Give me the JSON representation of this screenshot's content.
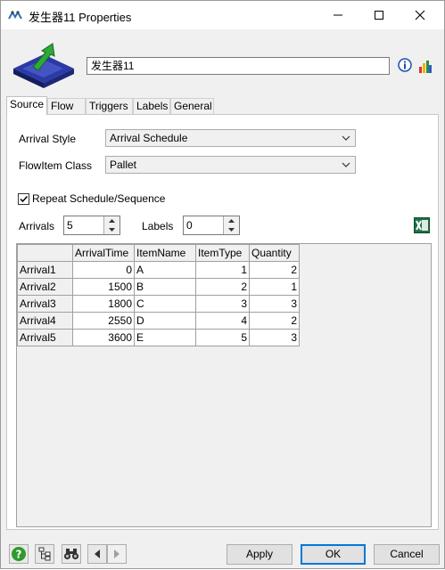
{
  "window": {
    "title": "发生器11  Properties"
  },
  "object": {
    "name": "发生器11"
  },
  "tabs": [
    "Source",
    "Flow",
    "Triggers",
    "Labels",
    "General"
  ],
  "source": {
    "arrival_style_label": "Arrival Style",
    "arrival_style_value": "Arrival Schedule",
    "flowitem_class_label": "FlowItem Class",
    "flowitem_class_value": "Pallet",
    "repeat_label": "Repeat Schedule/Sequence",
    "repeat_checked": true,
    "arrivals_label": "Arrivals",
    "arrivals_value": "5",
    "labels_label": "Labels",
    "labels_value": "0"
  },
  "table": {
    "columns": [
      "ArrivalTime",
      "ItemName",
      "ItemType",
      "Quantity"
    ],
    "rows": [
      {
        "header": "Arrival1",
        "cells": [
          "0",
          "A",
          "1",
          "2"
        ]
      },
      {
        "header": "Arrival2",
        "cells": [
          "1500",
          "B",
          "2",
          "1"
        ]
      },
      {
        "header": "Arrival3",
        "cells": [
          "1800",
          "C",
          "3",
          "3"
        ]
      },
      {
        "header": "Arrival4",
        "cells": [
          "2550",
          "D",
          "4",
          "2"
        ]
      },
      {
        "header": "Arrival5",
        "cells": [
          "3600",
          "E",
          "5",
          "3"
        ]
      }
    ]
  },
  "buttons": {
    "apply": "Apply",
    "ok": "OK",
    "cancel": "Cancel"
  },
  "icons": {
    "help": "help-icon",
    "tree": "tree-icon",
    "find": "binoculars-icon",
    "prev": "arrow-left-icon",
    "next": "arrow-right-icon",
    "excel": "excel-icon",
    "info": "info-icon",
    "chart": "chart-icon"
  },
  "colors": {
    "accent": "#0078d7",
    "excel": "#1e7145",
    "help": "#2e9a2e"
  }
}
